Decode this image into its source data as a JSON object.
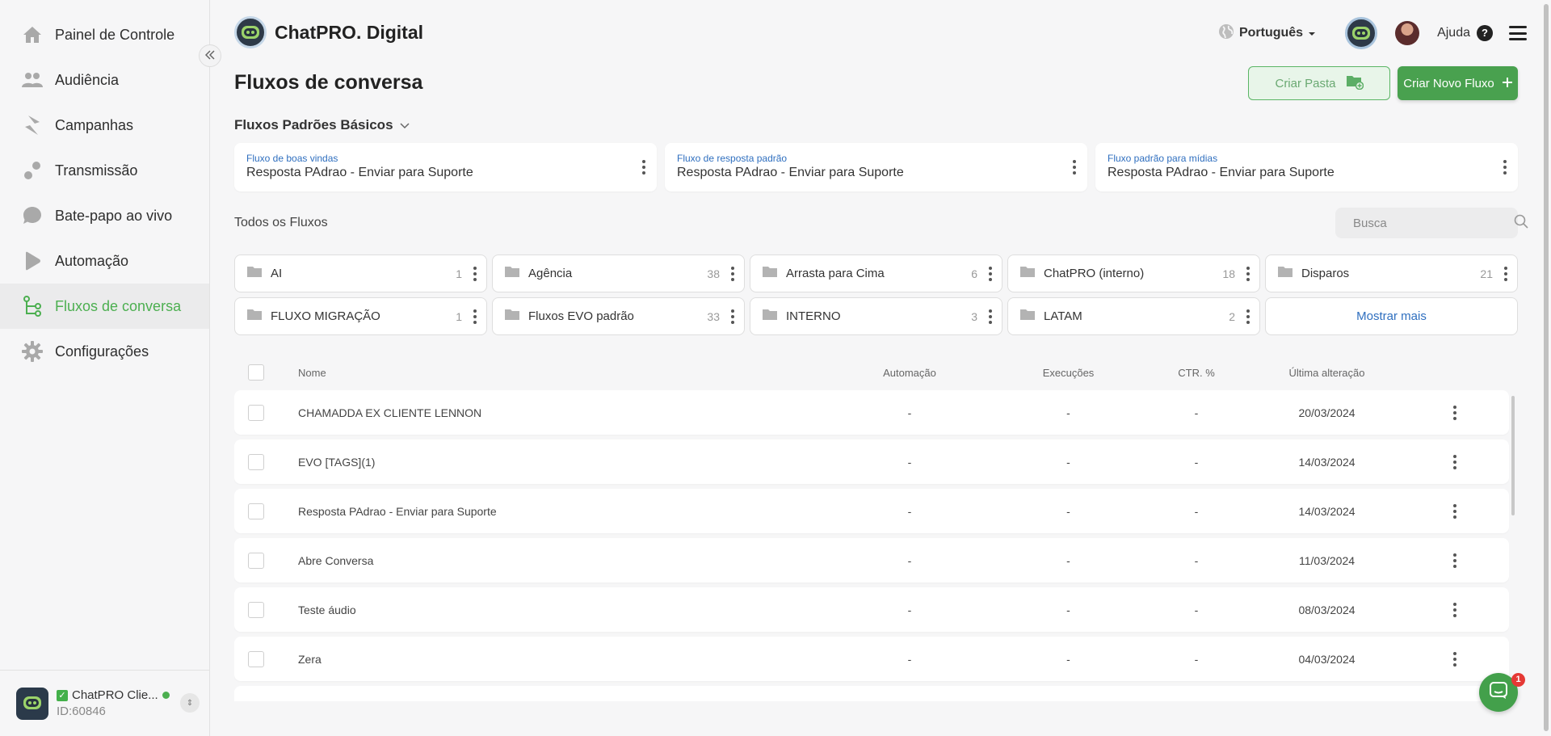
{
  "sidebar": {
    "items": [
      {
        "label": "Painel de Controle",
        "icon": "home-icon"
      },
      {
        "label": "Audiência",
        "icon": "people-icon"
      },
      {
        "label": "Campanhas",
        "icon": "campaign-icon"
      },
      {
        "label": "Transmissão",
        "icon": "broadcast-icon"
      },
      {
        "label": "Bate-papo ao vivo",
        "icon": "chat-bubble-icon"
      },
      {
        "label": "Automação",
        "icon": "play-icon"
      },
      {
        "label": "Fluxos de conversa",
        "icon": "flow-icon",
        "active": true
      },
      {
        "label": "Configurações",
        "icon": "gear-icon"
      }
    ],
    "collapse_icon": "double-chevron-left-icon",
    "account": {
      "name": "ChatPRO Clie...",
      "id": "ID:60846"
    }
  },
  "header": {
    "brand": "ChatPRO. Digital",
    "language": "Português",
    "help": "Ajuda"
  },
  "page": {
    "title": "Fluxos de conversa",
    "create_folder": "Criar Pasta",
    "create_flow": "Criar Novo Fluxo",
    "basic_section": "Fluxos Padrões Básicos",
    "all_section": "Todos os Fluxos",
    "search_placeholder": "Busca",
    "show_more": "Mostrar mais"
  },
  "default_flows": [
    {
      "label": "Fluxo de boas vindas",
      "value": "Resposta PAdrao - Enviar para Suporte"
    },
    {
      "label": "Fluxo de resposta padrão",
      "value": "Resposta PAdrao - Enviar para Suporte"
    },
    {
      "label": "Fluxo padrão para mídias",
      "value": "Resposta PAdrao - Enviar para Suporte"
    }
  ],
  "folders": [
    {
      "name": "AI",
      "count": "1"
    },
    {
      "name": "Agência",
      "count": "38"
    },
    {
      "name": "Arrasta para Cima",
      "count": "6"
    },
    {
      "name": "ChatPRO (interno)",
      "count": "18"
    },
    {
      "name": "Disparos",
      "count": "21"
    },
    {
      "name": "FLUXO MIGRAÇÃO",
      "count": "1"
    },
    {
      "name": "Fluxos EVO padrão",
      "count": "33"
    },
    {
      "name": "INTERNO",
      "count": "3"
    },
    {
      "name": "LATAM",
      "count": "2"
    }
  ],
  "table": {
    "columns": {
      "name": "Nome",
      "automation": "Automação",
      "executions": "Execuções",
      "ctr": "CTR. %",
      "last_modified": "Última alteração"
    },
    "rows": [
      {
        "name": "CHAMADDA EX CLIENTE LENNON",
        "automation": "-",
        "executions": "-",
        "ctr": "-",
        "date": "20/03/2024"
      },
      {
        "name": "EVO [TAGS](1)",
        "automation": "-",
        "executions": "-",
        "ctr": "-",
        "date": "14/03/2024"
      },
      {
        "name": "Resposta PAdrao - Enviar para Suporte",
        "automation": "-",
        "executions": "-",
        "ctr": "-",
        "date": "14/03/2024"
      },
      {
        "name": "Abre Conversa",
        "automation": "-",
        "executions": "-",
        "ctr": "-",
        "date": "11/03/2024"
      },
      {
        "name": "Teste áudio",
        "automation": "-",
        "executions": "-",
        "ctr": "-",
        "date": "08/03/2024"
      },
      {
        "name": "Zera",
        "automation": "-",
        "executions": "-",
        "ctr": "-",
        "date": "04/03/2024"
      }
    ]
  },
  "chat_widget": {
    "badge": "1"
  },
  "colors": {
    "accent": "#49a14f",
    "link": "#2f6fbf",
    "background": "#f6f6f7"
  }
}
